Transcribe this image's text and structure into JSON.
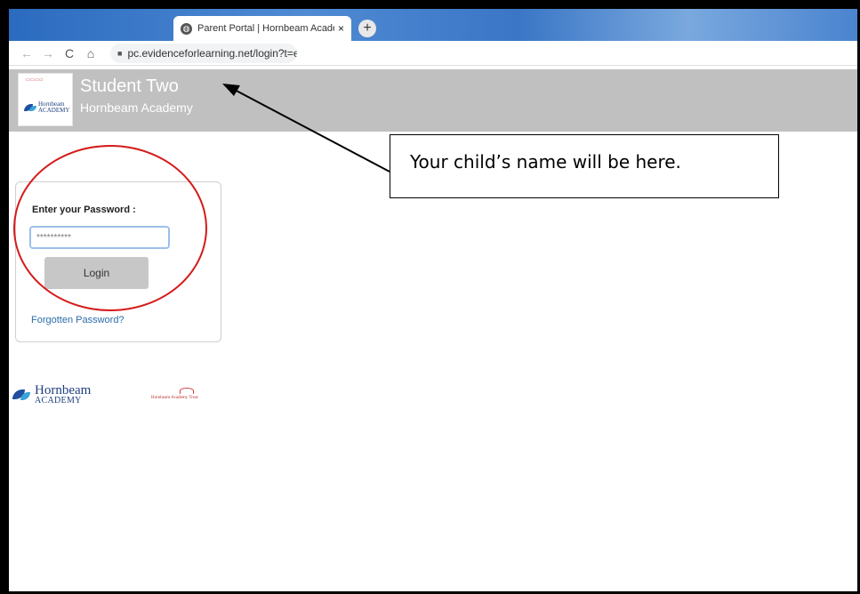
{
  "browser": {
    "tab_title": "Parent Portal | Hornbeam Acade",
    "tab_close": "×",
    "new_tab": "+",
    "url": "pc.evidenceforlearning.net/login?t=e",
    "back": "←",
    "forward": "→",
    "reload": "C",
    "home": "⌂"
  },
  "header": {
    "student_name": "Student Two",
    "school_name": "Hornbeam Academy",
    "logo_brand_line1": "Hornbeam",
    "logo_brand_line2": "ACADEMY"
  },
  "login": {
    "password_label": "Enter your Password :",
    "password_value": "**********",
    "login_button": "Login",
    "forgot_link": "Forgotten Password?"
  },
  "footer": {
    "logo1_name": "Hornbeam",
    "logo1_sub": "ACADEMY",
    "logo2_text": "Hornbeam Academy Trust"
  },
  "annotation": {
    "callout_text": "Your child’s name will be here."
  },
  "colors": {
    "header_bg": "#c0c0c0",
    "ellipse": "#d51a1a",
    "link": "#2b6da8"
  }
}
